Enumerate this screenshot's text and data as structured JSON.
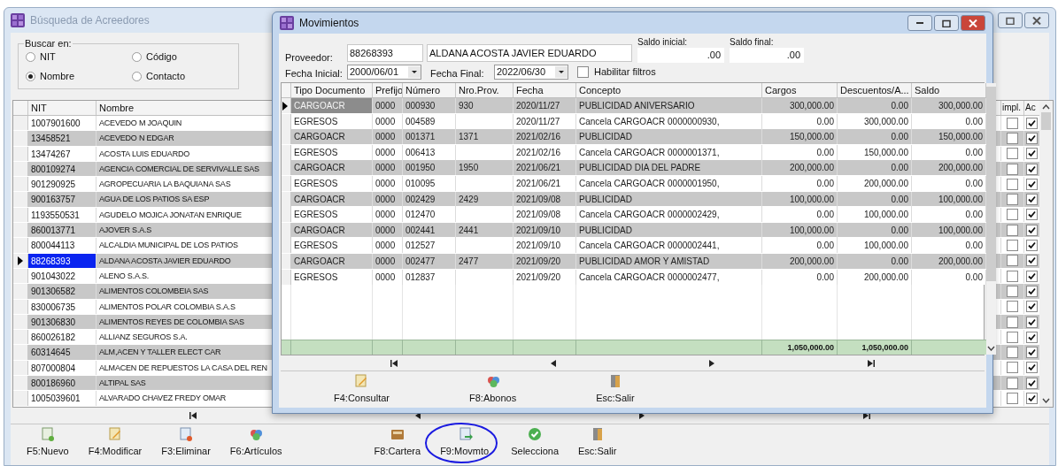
{
  "search_window": {
    "title": "Búsqueda de Acreedores"
  },
  "search_in": {
    "label": "Buscar en:",
    "options": [
      {
        "label": "NIT",
        "selected": false
      },
      {
        "label": "Código",
        "selected": false
      },
      {
        "label": "Nombre",
        "selected": true
      },
      {
        "label": "Contacto",
        "selected": false
      }
    ]
  },
  "creditors": {
    "columns": [
      "NIT",
      "Nombre",
      "impl.",
      "Ac"
    ],
    "rows": [
      {
        "nit": "1007901600",
        "name": "ACEVEDO M JOAQUIN",
        "selected": false,
        "impl": false,
        "ac": true
      },
      {
        "nit": "13458521",
        "name": "ACEVEDO N EDGAR",
        "selected": false,
        "impl": false,
        "ac": true
      },
      {
        "nit": "13474267",
        "name": "ACOSTA  LUIS EDUARDO",
        "selected": false,
        "impl": false,
        "ac": true
      },
      {
        "nit": "800109274",
        "name": "AGENCIA COMERCIAL DE SERVIVALLE SAS",
        "selected": false,
        "impl": false,
        "ac": true
      },
      {
        "nit": "901290925",
        "name": "AGROPECUARIA LA BAQUIANA SAS",
        "selected": false,
        "impl": false,
        "ac": true
      },
      {
        "nit": "900163757",
        "name": "AGUA DE LOS PATIOS SA ESP",
        "selected": false,
        "impl": false,
        "ac": true
      },
      {
        "nit": "1193550531",
        "name": "AGUDELO MOJICA JONATAN ENRIQUE",
        "selected": false,
        "impl": false,
        "ac": true
      },
      {
        "nit": "860013771",
        "name": "AJOVER S.A.S",
        "selected": false,
        "impl": false,
        "ac": true
      },
      {
        "nit": "800044113",
        "name": "ALCALDIA MUNICIPAL DE LOS PATIOS",
        "selected": false,
        "impl": false,
        "ac": true
      },
      {
        "nit": "88268393",
        "name": "ALDANA ACOSTA JAVIER EDUARDO",
        "selected": true,
        "impl": false,
        "ac": true
      },
      {
        "nit": "901043022",
        "name": "ALENO S.A.S.",
        "selected": false,
        "impl": false,
        "ac": true
      },
      {
        "nit": "901306582",
        "name": "ALIMENTOS COLOMBEIA SAS",
        "selected": false,
        "impl": false,
        "ac": true
      },
      {
        "nit": "830006735",
        "name": "ALIMENTOS POLAR COLOMBIA S.A.S",
        "selected": false,
        "impl": false,
        "ac": true
      },
      {
        "nit": "901306830",
        "name": "ALIMENTOS REYES DE COLOMBIA SAS",
        "selected": false,
        "impl": false,
        "ac": true
      },
      {
        "nit": "860026182",
        "name": "ALLIANZ SEGUROS S.A.",
        "selected": false,
        "impl": false,
        "ac": true
      },
      {
        "nit": "60314645",
        "name": "ALM,ACEN Y TALLER ELECT CAR",
        "selected": false,
        "impl": false,
        "ac": true
      },
      {
        "nit": "807000804",
        "name": "ALMACEN DE REPUESTOS LA CASA DEL REN",
        "selected": false,
        "impl": false,
        "ac": true
      },
      {
        "nit": "800186960",
        "name": "ALTIPAL SAS",
        "selected": false,
        "impl": false,
        "ac": true
      },
      {
        "nit": "1005039601",
        "name": "ALVARADO CHAVEZ FREDY OMAR",
        "selected": false,
        "impl": false,
        "ac": true
      }
    ]
  },
  "toolbar": [
    {
      "label": "F5:Nuevo",
      "circled": false
    },
    {
      "label": "F4:Modificar",
      "circled": false
    },
    {
      "label": "F3:Eliminar",
      "circled": false
    },
    {
      "label": "F6:Artículos",
      "circled": false
    },
    {
      "label": "F8:Cartera",
      "circled": false
    },
    {
      "label": "F9:Movmto.",
      "circled": true
    },
    {
      "label": "Selecciona",
      "circled": false
    },
    {
      "label": "Esc:Salir",
      "circled": false
    }
  ],
  "movements_window": {
    "title": "Movimientos",
    "supplier": {
      "label": "Proveedor:",
      "id": "88268393",
      "name": "ALDANA ACOSTA JAVIER EDUARDO"
    },
    "opening_balance": {
      "label": "Saldo inicial:",
      "value": ".00"
    },
    "closing_balance": {
      "label": "Saldo final:",
      "value": ".00"
    },
    "start_date": {
      "label": "Fecha Inicial:",
      "value": "2000/06/01"
    },
    "end_date": {
      "label": "Fecha Final:",
      "value": "2022/06/30"
    },
    "enable_filters": {
      "label": "Habilitar filtros",
      "checked": false
    },
    "columns": [
      "Tipo Documento",
      "Prefijo",
      "Número",
      "Nro.Prov.",
      "Fecha",
      "Concepto",
      "Cargos",
      "Descuentos/A...",
      "Saldo"
    ],
    "rows": [
      {
        "selected": true,
        "cells": [
          "CARGOACR",
          "0000",
          "000930",
          "930",
          "2020/11/27",
          "PUBLICIDAD ANIVERSARIO",
          "300,000.00",
          "0.00",
          "300,000.00"
        ]
      },
      {
        "selected": false,
        "cells": [
          "EGRESOS",
          "0000",
          "004589",
          "",
          "2020/11/27",
          "Cancela CARGOACR 0000000930,",
          "0.00",
          "300,000.00",
          "0.00"
        ]
      },
      {
        "selected": false,
        "cells": [
          "CARGOACR",
          "0000",
          "001371",
          "1371",
          "2021/02/16",
          "PUBLICIDAD",
          "150,000.00",
          "0.00",
          "150,000.00"
        ]
      },
      {
        "selected": false,
        "cells": [
          "EGRESOS",
          "0000",
          "006413",
          "",
          "2021/02/16",
          "Cancela CARGOACR 0000001371,",
          "0.00",
          "150,000.00",
          "0.00"
        ]
      },
      {
        "selected": false,
        "cells": [
          "CARGOACR",
          "0000",
          "001950",
          "1950",
          "2021/06/21",
          "PUBLICIDAD DIA DEL PADRE",
          "200,000.00",
          "0.00",
          "200,000.00"
        ]
      },
      {
        "selected": false,
        "cells": [
          "EGRESOS",
          "0000",
          "010095",
          "",
          "2021/06/21",
          "Cancela CARGOACR 0000001950,",
          "0.00",
          "200,000.00",
          "0.00"
        ]
      },
      {
        "selected": false,
        "cells": [
          "CARGOACR",
          "0000",
          "002429",
          "2429",
          "2021/09/08",
          "PUBLICIDAD",
          "100,000.00",
          "0.00",
          "100,000.00"
        ]
      },
      {
        "selected": false,
        "cells": [
          "EGRESOS",
          "0000",
          "012470",
          "",
          "2021/09/08",
          "Cancela CARGOACR 0000002429,",
          "0.00",
          "100,000.00",
          "0.00"
        ]
      },
      {
        "selected": false,
        "cells": [
          "CARGOACR",
          "0000",
          "002441",
          "2441",
          "2021/09/10",
          "PUBLICIDAD",
          "100,000.00",
          "0.00",
          "100,000.00"
        ]
      },
      {
        "selected": false,
        "cells": [
          "EGRESOS",
          "0000",
          "012527",
          "",
          "2021/09/10",
          "Cancela CARGOACR 0000002441,",
          "0.00",
          "100,000.00",
          "0.00"
        ]
      },
      {
        "selected": false,
        "cells": [
          "CARGOACR",
          "0000",
          "002477",
          "2477",
          "2021/09/20",
          "PUBLICIDAD AMOR Y AMISTAD",
          "200,000.00",
          "0.00",
          "200,000.00"
        ]
      },
      {
        "selected": false,
        "cells": [
          "EGRESOS",
          "0000",
          "012837",
          "",
          "2021/09/20",
          "Cancela CARGOACR 0000002477,",
          "0.00",
          "200,000.00",
          "0.00"
        ]
      }
    ],
    "totals": {
      "charges": "1,050,000.00",
      "discounts": "1,050,000.00"
    },
    "toolbar": [
      "F4:Consultar",
      "F8:Abonos",
      "Esc:Salir"
    ]
  }
}
